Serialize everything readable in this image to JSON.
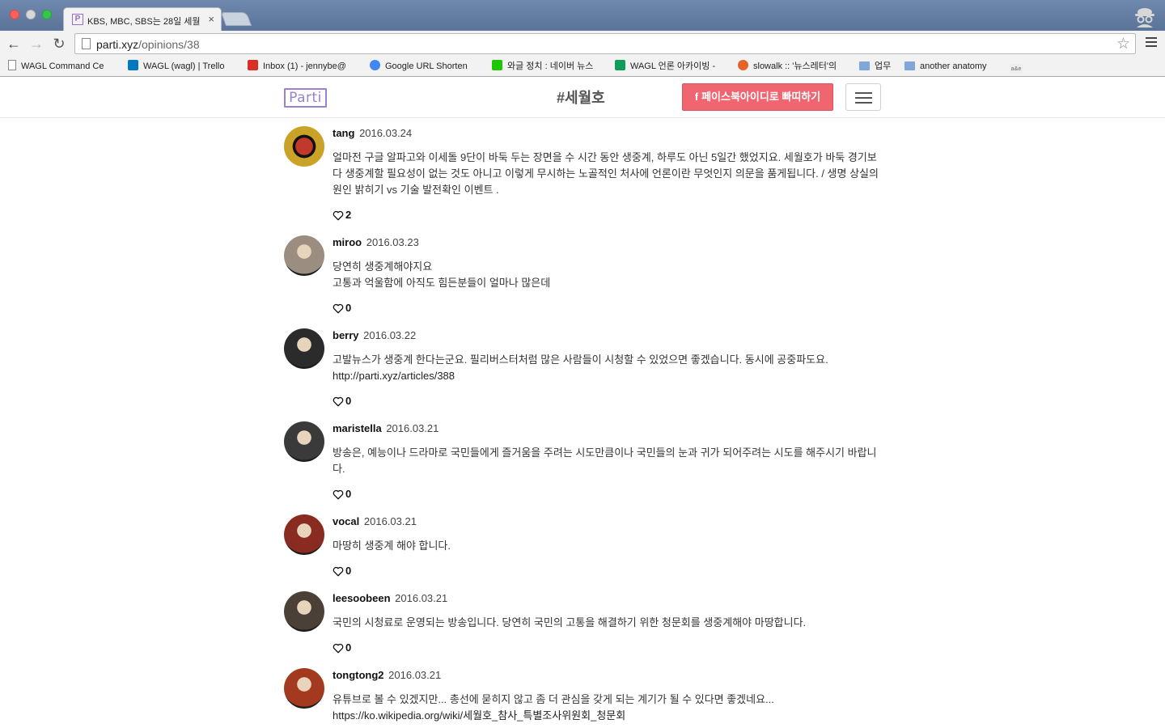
{
  "browser": {
    "tab_title": "KBS, MBC, SBS는 28일 세월",
    "tab_close": "×",
    "url_host": "parti.xyz",
    "url_path": "/opinions/38",
    "bookmarks": [
      {
        "label": "WAGL Command Ce",
        "icon": "page-icon",
        "color": "#888888"
      },
      {
        "label": "WAGL (wagl) | Trello",
        "icon": "trello-icon",
        "color": "#0079bf"
      },
      {
        "label": "Inbox (1) - jennybe@",
        "icon": "gmail-icon",
        "color": "#d93025"
      },
      {
        "label": "Google URL Shorten",
        "icon": "google-icon",
        "color": "#4285f4"
      },
      {
        "label": "와글 정치 : 네이버 뉴스",
        "icon": "naver-icon",
        "color": "#1ec800"
      },
      {
        "label": "WAGL 언론 아카이빙 -",
        "icon": "sheets-icon",
        "color": "#0f9d58"
      },
      {
        "label": "slowalk :: '뉴스레터'의",
        "icon": "slowalk-icon",
        "color": "#e8632b"
      },
      {
        "label": "업무",
        "icon": "folder-icon",
        "color": "#7fa7d9"
      },
      {
        "label": "another anatomy",
        "icon": "folder-icon",
        "color": "#7fa7d9"
      },
      {
        "label": "a&e",
        "icon": "ae-icon",
        "color": "#bbbbbb"
      }
    ]
  },
  "header": {
    "logo": "Parti",
    "topic": "#세월호",
    "facebook_login": "페이스북아이디로 빠띠하기",
    "facebook_glyph": "f"
  },
  "opinions": [
    {
      "user": "tang",
      "date": "2016.03.24",
      "lines": [
        "얼마전 구글 알파고와 이세돌 9단이 바둑 두는 장면을 수 시간 동안 생중계, 하루도 아닌 5일간 했었지요. 세월호가 바둑 경기보다 생중계할 필요성이 없는 것도 아니고 이렇게 무시하는 노골적인 처사에 언론이란 무엇인지 의문을 품게됩니다. / 생명 상실의 원인 밝히기 vs 기술 발전확인 이벤트 ."
      ],
      "likes": "2",
      "avatar_color": "#c9a227"
    },
    {
      "user": "miroo",
      "date": "2016.03.23",
      "lines": [
        "당연히 생중계해야지요",
        "고통과 억울함에 아직도 힘든분들이 얼마나 많은데"
      ],
      "likes": "0",
      "avatar_color": "#9b8e80"
    },
    {
      "user": "berry",
      "date": "2016.03.22",
      "lines": [
        "고발뉴스가 생중계 한다는군요. 필리버스터처럼 많은 사람들이 시청할 수 있었으면 좋겠습니다. 동시에 공중파도요.",
        "http://parti.xyz/articles/388"
      ],
      "likes": "0",
      "avatar_color": "#2b2b2b"
    },
    {
      "user": "maristella",
      "date": "2016.03.21",
      "lines": [
        "방송은, 예능이나 드라마로 국민들에게 즐거움을 주려는 시도만큼이나 국민들의 눈과 귀가 되어주려는 시도를 해주시기 바랍니다."
      ],
      "likes": "0",
      "avatar_color": "#3a3a3a"
    },
    {
      "user": "vocal",
      "date": "2016.03.21",
      "lines": [
        "마땅히 생중계 해야 합니다."
      ],
      "likes": "0",
      "avatar_color": "#8a2b22"
    },
    {
      "user": "leesoobeen",
      "date": "2016.03.21",
      "lines": [
        "국민의 시청료로 운영되는 방송입니다. 당연히 국민의 고통을 해결하기 위한 청문회를 생중계해야 마땅합니다."
      ],
      "likes": "0",
      "avatar_color": "#4a4038"
    },
    {
      "user": "tongtong2",
      "date": "2016.03.21",
      "lines": [
        "유튜브로 볼 수 있겠지만... 총선에 묻히지 않고 좀 더 관심을 갖게 되는 계기가 될 수 있다면 좋겠네요...",
        "https://ko.wikipedia.org/wiki/세월호_참사_특별조사위원회_청문회"
      ],
      "likes": "",
      "avatar_color": "#a33a1f"
    }
  ]
}
